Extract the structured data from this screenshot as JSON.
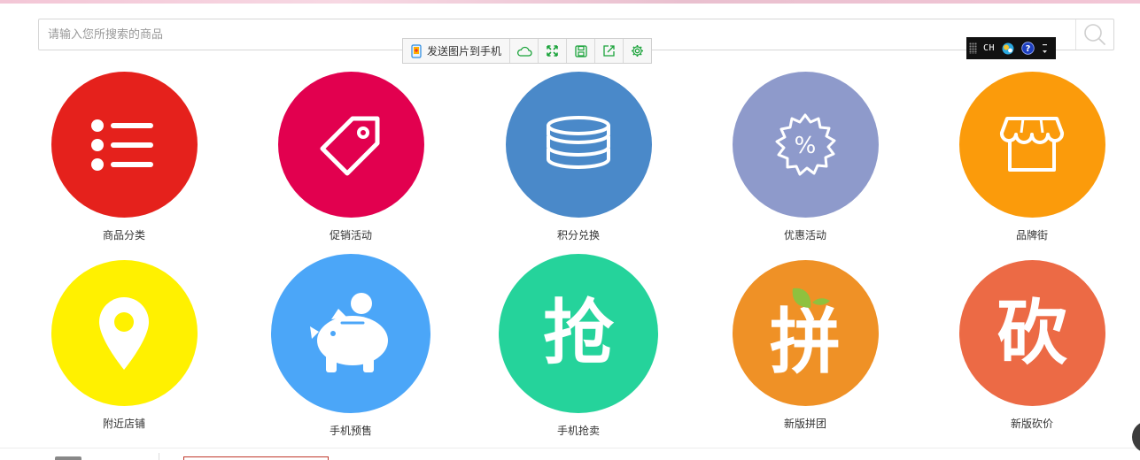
{
  "search": {
    "placeholder": "请输入您所搜索的商品",
    "button_icon": "search-icon"
  },
  "float_toolbar": {
    "send_label": "发送图片到手机",
    "tools": [
      {
        "icon": "phone-send-icon"
      },
      {
        "icon": "cloud-icon"
      },
      {
        "icon": "expand-icon"
      },
      {
        "icon": "save-icon"
      },
      {
        "icon": "share-icon"
      },
      {
        "icon": "settings-icon"
      }
    ]
  },
  "ime": {
    "lang": "CH",
    "icons": [
      "ime-logo-icon",
      "help-icon",
      "ime-menu-icon"
    ]
  },
  "categories": [
    {
      "label": "商品分类",
      "color": "#e5211c",
      "icon": "list-icon"
    },
    {
      "label": "促销活动",
      "color": "#e2004f",
      "icon": "tag-icon"
    },
    {
      "label": "积分兑换",
      "color": "#4a89c9",
      "icon": "coin-stack-icon"
    },
    {
      "label": "优惠活动",
      "color": "#8e9acb",
      "icon": "percent-badge-icon"
    },
    {
      "label": "品牌街",
      "color": "#fb9b0b",
      "icon": "storefront-icon"
    },
    {
      "label": "附近店铺",
      "color": "#fff100",
      "icon": "location-pin-icon"
    },
    {
      "label": "手机预售",
      "color": "#4ba6f8",
      "icon": "piggy-bank-icon"
    },
    {
      "label": "手机抢卖",
      "color": "#25d39b",
      "icon": "grab-character-icon",
      "glyph": "抢"
    },
    {
      "label": "新版拼团",
      "color": "#ef9126",
      "icon": "group-buy-character-icon",
      "glyph": "拼"
    },
    {
      "label": "新版砍价",
      "color": "#ec6a45",
      "icon": "bargain-character-icon",
      "glyph": "砍"
    }
  ]
}
